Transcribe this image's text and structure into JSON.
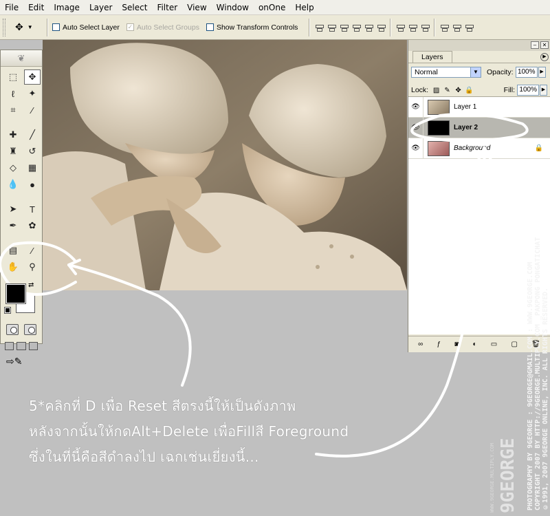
{
  "menu": [
    "File",
    "Edit",
    "Image",
    "Layer",
    "Select",
    "Filter",
    "View",
    "Window",
    "onOne",
    "Help"
  ],
  "options": {
    "auto_select_layer": "Auto Select Layer",
    "auto_select_groups": "Auto Select Groups",
    "show_transform_controls": "Show Transform Controls"
  },
  "layers_panel": {
    "tab": "Layers",
    "blend_mode": "Normal",
    "opacity_label": "Opacity:",
    "opacity_value": "100%",
    "lock_label": "Lock:",
    "fill_label": "Fill:",
    "fill_value": "100%",
    "layers": [
      {
        "name": "Layer 1",
        "thumb_color": "#b8a58c"
      },
      {
        "name": "Layer 2",
        "thumb_color": "#000000"
      },
      {
        "name": "Background",
        "thumb_color": "#c98a86"
      }
    ]
  },
  "annotation": {
    "line1": "5*คลิกที่ D เพื่อ Reset สีตรงนี้ให้เป็นดังภาพ",
    "line2": "หลังจากนั้นให้กดAlt+Delete เพื่อFillสี Foreground",
    "line3": "ซึ่งในที่นี้คือสีดำลงไป เฉกเช่นเยี่ยงนี้..."
  },
  "watermark": {
    "credit1": "PHOTOGRAPHY BY 9GEORGE : 9GEORGE@GMAIL.COM : WWW.9GEORGE.COM",
    "credit2": "COPYRIGHT 2007 BY HTTP://9GEORGE.MULTIPLY.COM _PAKPONG PONGATICHAT",
    "credit3": "©1991, 2007 9GEORGE ONLINE, INC. ALL RIGHTS RESERVED.",
    "brand": "9GEORGE",
    "site": "WWW.9GEORGE.MULTIPLY.COM"
  }
}
